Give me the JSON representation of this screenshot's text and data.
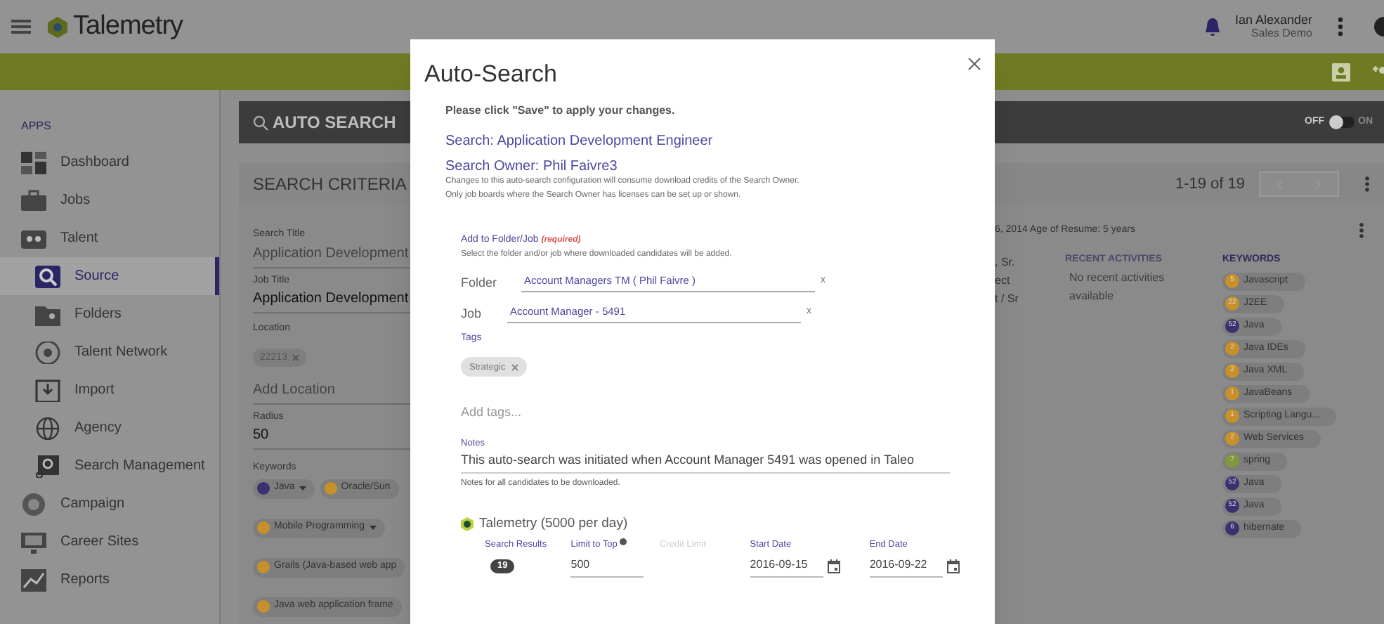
{
  "header": {
    "logo": "Talemetry",
    "user_name": "Ian Alexander",
    "user_org": "Sales Demo"
  },
  "sidebar": {
    "heading": "APPS",
    "items": [
      {
        "label": "Dashboard",
        "selected": false
      },
      {
        "label": "Jobs",
        "selected": false
      },
      {
        "label": "Talent",
        "selected": false,
        "children": [
          {
            "label": "Source",
            "selected": true
          },
          {
            "label": "Folders",
            "selected": false
          },
          {
            "label": "Talent Network",
            "selected": false
          },
          {
            "label": "Import",
            "selected": false
          },
          {
            "label": "Agency",
            "selected": false
          },
          {
            "label": "Search Management",
            "selected": false
          }
        ]
      },
      {
        "label": "Campaign",
        "selected": false
      },
      {
        "label": "Career Sites",
        "selected": false
      },
      {
        "label": "Reports",
        "selected": false
      }
    ]
  },
  "toolbar": {
    "title": "AUTO SEARCH",
    "toggle": {
      "off_label": "OFF",
      "on_label": "ON",
      "on": false
    }
  },
  "criteria": {
    "heading": "SEARCH CRITERIA",
    "pager": "1-19 of 19",
    "search_title": {
      "label": "Search Title",
      "value": "Application Development"
    },
    "job_title": {
      "label": "Job Title",
      "value": "Application Development"
    },
    "location": {
      "label": "Location",
      "chips": [
        "22213"
      ],
      "placeholder": "Add Location"
    },
    "radius": {
      "label": "Radius",
      "value": "50"
    },
    "keywords": {
      "label": "Keywords",
      "chips": [
        {
          "label": "Java",
          "color": "#3b3170",
          "dropdown": true
        },
        {
          "label": "Oracle/Sun",
          "color": "#c8902a",
          "dropdown": false
        },
        {
          "label": "Mobile Programming",
          "color": "#c8902a",
          "dropdown": true
        },
        {
          "label": "Grails (Java-based web app",
          "color": "#c8902a",
          "dropdown": false
        },
        {
          "label": "Java web application frame",
          "color": "#c8902a",
          "dropdown": false
        }
      ]
    }
  },
  "result": {
    "meta": "6, 2014 Age of Resume: 5 years",
    "title_lines": [
      ", Sr.",
      "ect",
      "t / Sr"
    ],
    "recent_heading": "RECENT ACTIVITIES",
    "recent_text": "No recent activities available",
    "keywords_heading": "KEYWORDS",
    "keywords": [
      {
        "count": "5",
        "label": "Javascript",
        "color": "#c8902a"
      },
      {
        "count": "22",
        "label": "J2EE",
        "color": "#c8902a"
      },
      {
        "count": "52",
        "label": "Java",
        "color": "#3b3170"
      },
      {
        "count": "2",
        "label": "Java IDEs",
        "color": "#c8902a"
      },
      {
        "count": "2",
        "label": "Java XML",
        "color": "#c8902a"
      },
      {
        "count": "1",
        "label": "JavaBeans",
        "color": "#c8902a"
      },
      {
        "count": "1",
        "label": "Scripting Langu...",
        "color": "#c8902a"
      },
      {
        "count": "2",
        "label": "Web Services",
        "color": "#c8902a"
      },
      {
        "count": "7",
        "label": "spring",
        "color": "#7f9a3a"
      },
      {
        "count": "52",
        "label": "Java",
        "color": "#3b3170"
      },
      {
        "count": "52",
        "label": "Java",
        "color": "#3b3170"
      },
      {
        "count": "6",
        "label": "hibernate",
        "color": "#3b3170"
      }
    ]
  },
  "modal": {
    "title": "Auto-Search",
    "instruction": "Please click \"Save\" to apply your changes.",
    "search": "Search: Application Development Engineer",
    "owner": "Search Owner: Phil Faivre3",
    "owner_notes": [
      "Changes to this auto-search configuration will consume download credits of the Search Owner.",
      "Only job boards where the Search Owner has licenses can be set up or shown."
    ],
    "folder_section": {
      "label": "Add to Folder/Job",
      "required": "(required)",
      "help": "Select the folder and/or job where downloaded candidates will be added.",
      "fields": [
        {
          "label": "Folder",
          "value": "Account Managers TM ( Phil Faivre )",
          "clear": "x"
        },
        {
          "label": "Job",
          "value": "Account Manager - 5491",
          "clear": "x"
        }
      ]
    },
    "tags": {
      "label": "Tags",
      "chips": [
        "Strategic"
      ],
      "placeholder": "Add tags..."
    },
    "notes": {
      "label": "Notes",
      "value": "This auto-search was initiated when Account Manager 5491 was opened in Taleo",
      "help": "Notes for all candidates to be downloaded."
    },
    "board": {
      "name": "Talemetry (5000 per day)",
      "columns": [
        {
          "label": "Search Results",
          "kind": "badge",
          "value": "19",
          "disabled": false
        },
        {
          "label": "Limit to Top",
          "kind": "input",
          "value": "500",
          "info": true,
          "disabled": false
        },
        {
          "label": "Credit Limit",
          "kind": "input",
          "disabled": true
        },
        {
          "label": "Start Date",
          "kind": "date",
          "value": "2016-09-15",
          "disabled": false
        },
        {
          "label": "End Date",
          "kind": "date",
          "value": "2016-09-22",
          "disabled": false
        }
      ]
    }
  }
}
